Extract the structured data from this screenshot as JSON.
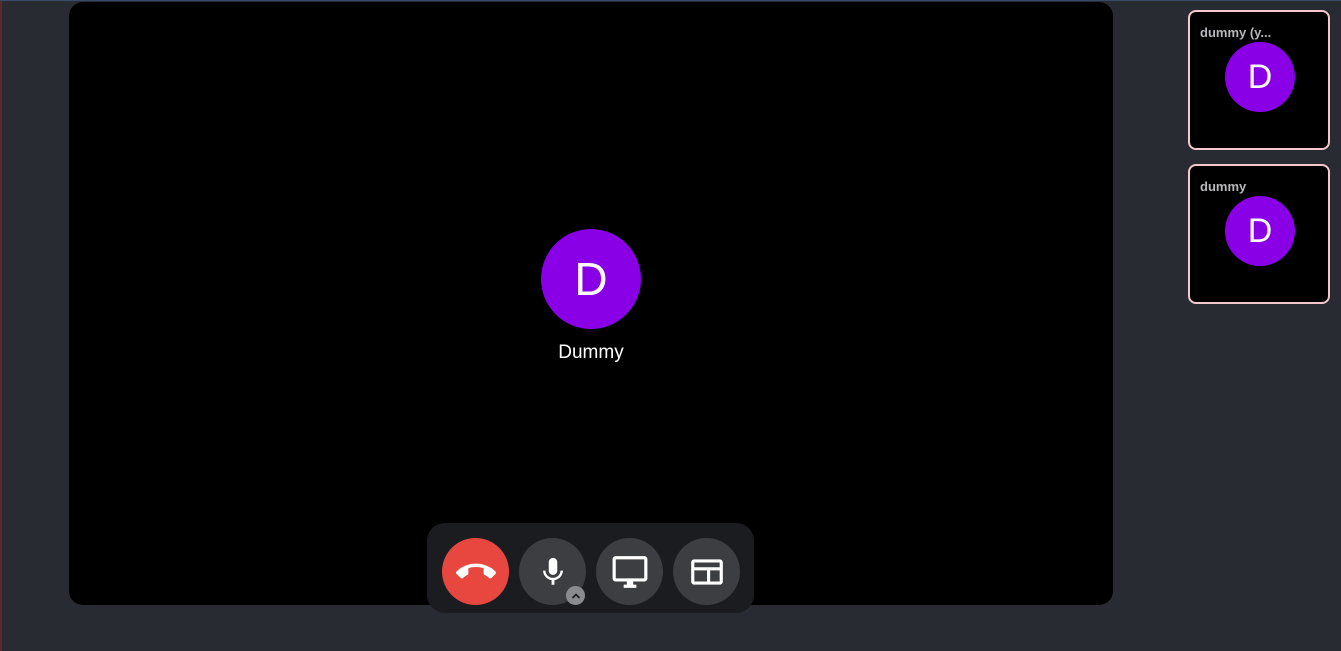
{
  "main": {
    "participant": {
      "initial": "D",
      "name": "Dummy"
    },
    "avatar_color": "#8a00e6"
  },
  "controls": {
    "hangup": {
      "icon": "phone-hangup-icon",
      "color": "#e8473f"
    },
    "microphone": {
      "icon": "microphone-icon"
    },
    "microphone_options": {
      "icon": "chevron-up-icon"
    },
    "screen_share": {
      "icon": "monitor-icon"
    },
    "layout": {
      "icon": "layout-icon"
    }
  },
  "sidebar": {
    "tiles": [
      {
        "name": "dummy (y...",
        "initial": "D"
      },
      {
        "name": "dummy",
        "initial": "D"
      }
    ],
    "border_color": "#f4c8cc"
  }
}
